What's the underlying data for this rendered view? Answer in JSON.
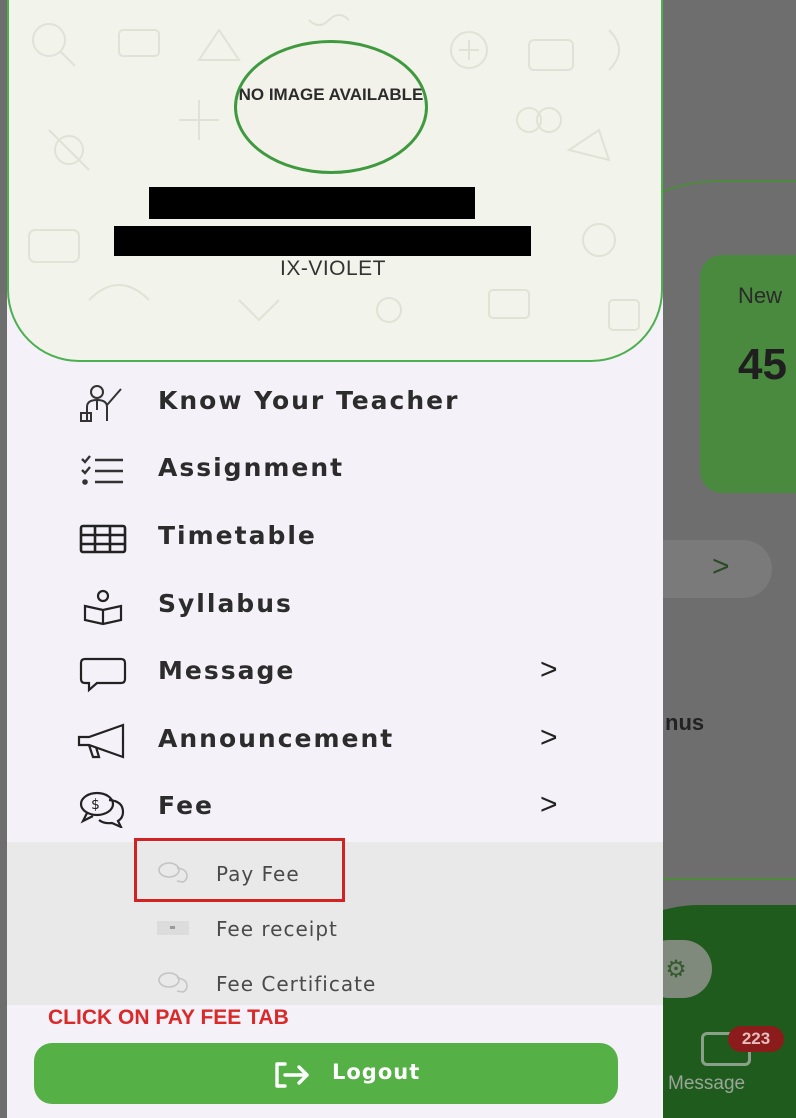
{
  "background_app": {
    "card_label": "New",
    "card_value": "45",
    "partial_text": "nus",
    "chevron": ">",
    "message_badge": "223",
    "message_label": "Message"
  },
  "profile": {
    "avatar_text": "NO IMAGE AVAILABLE",
    "class_section": "IX-VIOLET"
  },
  "menu": [
    {
      "label": "Know Your Teacher",
      "icon": "teacher-icon"
    },
    {
      "label": "Assignment",
      "icon": "checklist-icon"
    },
    {
      "label": "Timetable",
      "icon": "grid-icon"
    },
    {
      "label": "Syllabus",
      "icon": "book-icon"
    },
    {
      "label": "Message",
      "icon": "chat-bubble-icon",
      "chevron": ">"
    },
    {
      "label": "Announcement",
      "icon": "megaphone-icon",
      "chevron": ">"
    },
    {
      "label": "Fee",
      "icon": "money-chat-icon",
      "chevron": ">"
    }
  ],
  "fee_submenu": [
    {
      "label": "Pay Fee",
      "icon": "money-chat-icon"
    },
    {
      "label": "Fee receipt",
      "icon": "receipt-icon"
    },
    {
      "label": "Fee Certificate",
      "icon": "money-chat-icon"
    }
  ],
  "instruction": "CLICK ON PAY FEE TAB",
  "logout": {
    "label": "Logout",
    "icon": "logout-icon"
  },
  "colors": {
    "accent_green": "#55b046",
    "highlight_red": "#d32222",
    "drawer_bg": "#f4f1f8"
  }
}
